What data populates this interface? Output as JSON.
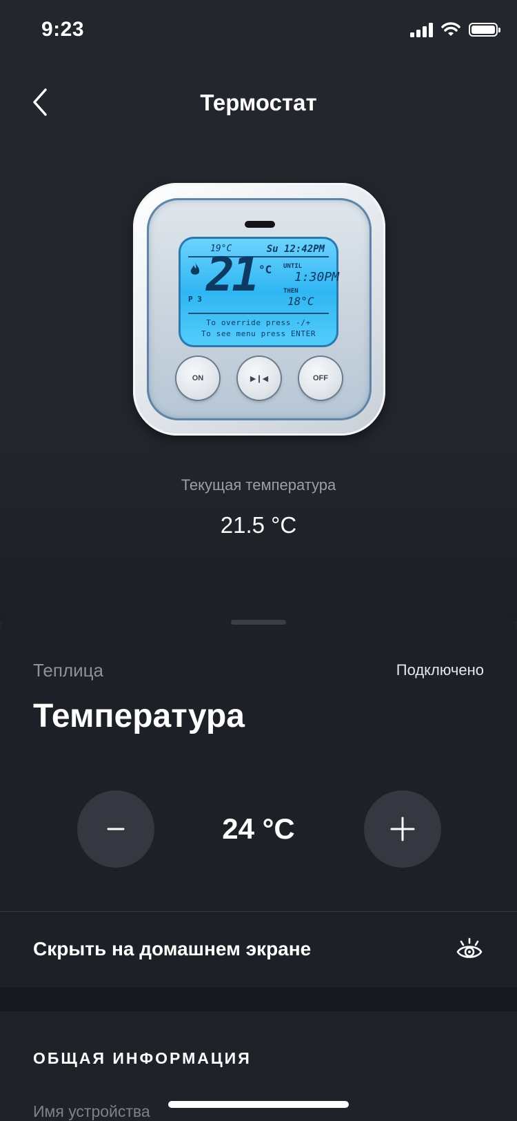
{
  "status_bar": {
    "time": "9:23"
  },
  "nav": {
    "title": "Термостат"
  },
  "device_screen": {
    "top_temp": "19°C",
    "top_time": "Su 12:42PM",
    "big_temp": "21",
    "big_unit": "°C",
    "until_label": "UNTIL",
    "until_time": "1:30PM",
    "then_label": "THEN",
    "then_temp": "18°C",
    "program_icon": "P 3",
    "message_1": "To override press -/+",
    "message_2": "To see menu press ENTER",
    "buttons": {
      "on": "ON",
      "play": "▶❙◀",
      "off": "OFF"
    }
  },
  "current": {
    "label": "Текущая температура",
    "value": "21.5 °C"
  },
  "sheet": {
    "room": "Теплица",
    "connection_status": "Подключено",
    "title": "Температура",
    "setpoint": "24 °C",
    "hide_label": "Скрыть на домашнем экране",
    "info_heading": "ОБЩАЯ ИНФОРМАЦИЯ",
    "device_name_label": "Имя устройства"
  },
  "icons": {
    "back": "chevron-left-icon",
    "minus": "minus-icon",
    "plus": "plus-icon",
    "eye": "eye-icon",
    "signal": "signal-icon",
    "wifi": "wifi-icon",
    "battery": "battery-icon"
  },
  "colors": {
    "background": "#22252c",
    "sheet": "#1d2027",
    "stepper": "#353840",
    "lcd": "#2fb6f2"
  }
}
